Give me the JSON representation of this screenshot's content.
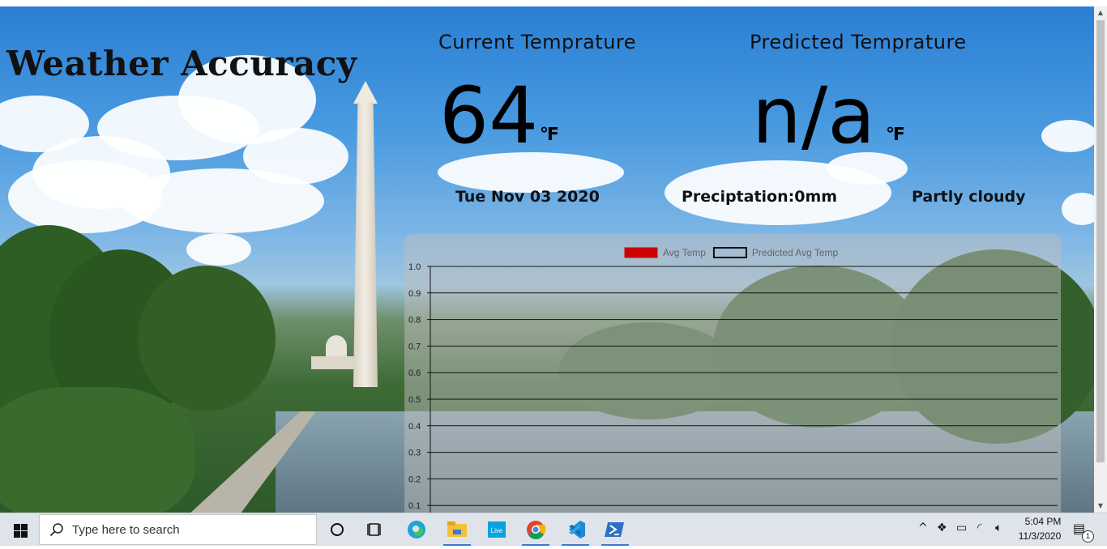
{
  "page": {
    "title": "Weather Accuracy",
    "current": {
      "heading": "Current Temprature",
      "value": "64",
      "unit": "℉"
    },
    "predicted": {
      "heading": "Predicted Temprature",
      "value": "n/a",
      "unit": "℉"
    },
    "date": "Tue Nov 03 2020",
    "precipitation": "Preciptation:0mm",
    "condition": "Partly cloudy"
  },
  "chart_data": {
    "type": "line",
    "legend": [
      {
        "label": "Avg Temp",
        "color": "#cc0000",
        "fill": true
      },
      {
        "label": "Predicted Avg Temp",
        "color": "#111111",
        "fill": false
      }
    ],
    "legend_position": "top-center",
    "series": [
      {
        "name": "Avg Temp",
        "values": []
      },
      {
        "name": "Predicted Avg Temp",
        "values": []
      }
    ],
    "y_ticks": [
      "1.0",
      "0.9",
      "0.8",
      "0.7",
      "0.6",
      "0.5",
      "0.4",
      "0.3",
      "0.2",
      "0.1"
    ],
    "ylim": [
      0,
      1.0
    ],
    "grid": true
  },
  "taskbar": {
    "search_placeholder": "Type here to search",
    "apps": [
      "task-view",
      "edge",
      "file-explorer",
      "live",
      "chrome",
      "vscode",
      "powershell"
    ],
    "live_label": "Live",
    "clock_time": "5:04 PM",
    "clock_date": "11/3/2020",
    "notification_count": "1"
  },
  "colors": {
    "accent_blue": "#3b7bd4",
    "legend_red": "#cc0000"
  }
}
